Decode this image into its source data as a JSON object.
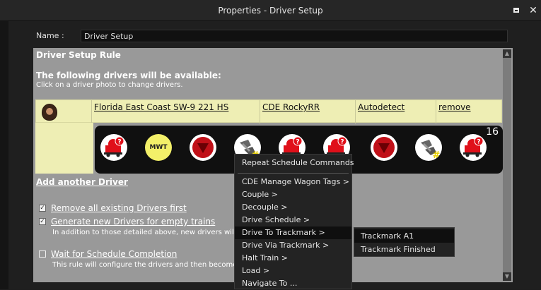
{
  "window": {
    "title": "Properties - Driver Setup"
  },
  "name_field": {
    "label": "Name :",
    "value": "Driver Setup"
  },
  "rule": {
    "title": "Driver Setup Rule",
    "heading": "The following drivers will be available:",
    "subheading": "Click on a driver photo to change drivers."
  },
  "driver": {
    "train": "Florida East Coast SW-9 221 HS",
    "session": "CDE RockyRR",
    "mode": "Autodetect",
    "remove": "remove"
  },
  "commands": {
    "count": "16",
    "icons": [
      "load-question-icon",
      "mwt-icon",
      "drive-down-icon",
      "coupler-hash-icon",
      "load-question-icon",
      "load-question-icon",
      "drive-down-icon",
      "coupler-hash-icon",
      "load-question-icon"
    ],
    "mwt_label": "MWT"
  },
  "add_driver": "Add another Driver",
  "options": [
    {
      "label": "Remove all existing Drivers first",
      "checked": true,
      "desc": ""
    },
    {
      "label": "Generate new Drivers for empty trains",
      "checked": true,
      "desc": "In addition to those detailed above, new drivers will b"
    },
    {
      "label": "Wait for Schedule Completion",
      "checked": false,
      "desc": "This rule will configure the drivers and then become"
    }
  ],
  "context_menu": {
    "items": [
      "Repeat Schedule Commands",
      "CDE Manage Wagon Tags >",
      "Couple >",
      "Decouple >",
      "Drive Schedule >",
      "Drive To Trackmark >",
      "Drive Via Trackmark >",
      "Halt Train >",
      "Load >",
      "Navigate To ..."
    ],
    "highlighted": "Drive To Trackmark >"
  },
  "submenu": {
    "items": [
      "Trackmark A1",
      "Trackmark Finished"
    ]
  },
  "colors": {
    "panel": "#999999",
    "row": "#eeeeb4",
    "menu": "#232323",
    "stop_red": "#e0101a"
  }
}
